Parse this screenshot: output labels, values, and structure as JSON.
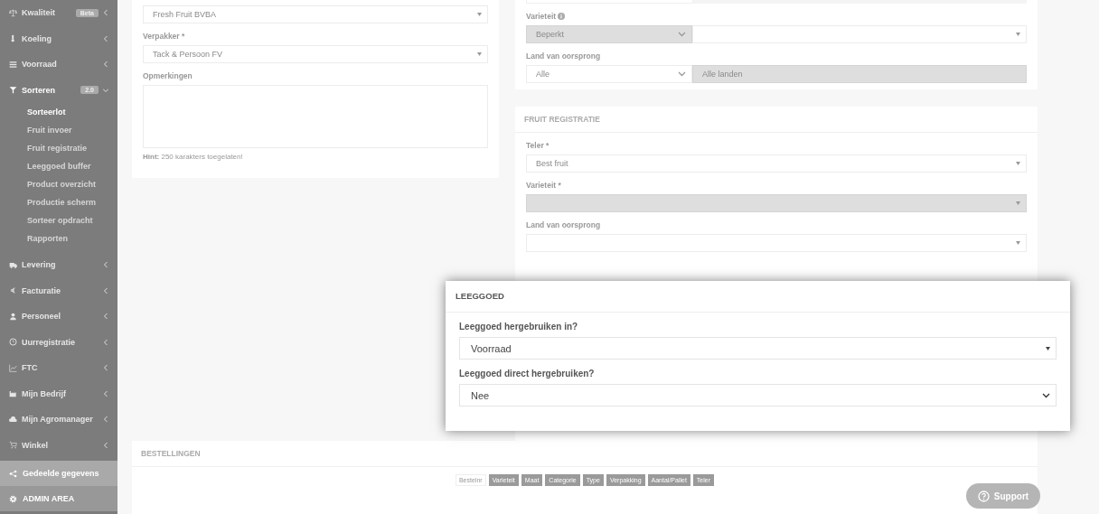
{
  "sidebar": {
    "items": [
      {
        "label": "Kwaliteit",
        "badge": "Beta",
        "expanded": false
      },
      {
        "label": "Koeling",
        "expanded": false
      },
      {
        "label": "Voorraad",
        "expanded": false
      },
      {
        "label": "Sorteren",
        "badge": "2.0",
        "expanded": true,
        "children": [
          {
            "label": "Sorteerlot",
            "selected": true
          },
          {
            "label": "Fruit invoer",
            "selected": false
          },
          {
            "label": "Fruit registratie",
            "selected": false
          },
          {
            "label": "Leeggoed buffer",
            "selected": false
          },
          {
            "label": "Product overzicht",
            "selected": false
          },
          {
            "label": "Productie scherm",
            "selected": false
          },
          {
            "label": "Sorteer opdracht",
            "selected": false
          },
          {
            "label": "Rapporten",
            "selected": false
          }
        ]
      },
      {
        "label": "Levering",
        "expanded": false
      },
      {
        "label": "Facturatie",
        "expanded": false
      },
      {
        "label": "Personeel",
        "expanded": false
      },
      {
        "label": "Uurregistratie",
        "expanded": false
      },
      {
        "label": "FTC",
        "expanded": false
      },
      {
        "label": "Mijn Bedrijf",
        "expanded": false
      },
      {
        "label": "Mijn Agromanager",
        "expanded": false
      },
      {
        "label": "Winkel",
        "expanded": false
      }
    ],
    "footer_items": [
      {
        "label": "Gedeelde gegevens",
        "kind": "shared"
      },
      {
        "label": "ADMIN AREA",
        "kind": "admin"
      }
    ]
  },
  "left_card": {
    "fields": [
      {
        "value": "Fresh Fruit BVBA"
      },
      {
        "label": "Verpakker *",
        "value": "Tack & Persoon FV"
      }
    ],
    "remarks": {
      "label": "Opmerkingen",
      "hint": "**Hint:** 250 karakters toegelaten!"
    }
  },
  "filter_card": {
    "rows": [
      {
        "label": "Varieteit",
        "info": true,
        "select": "Beperkt",
        "second": {
          "kind": "select"
        }
      },
      {
        "label": "Land van oorsprong",
        "info": false,
        "select": "Alle",
        "second": {
          "kind": "readonly",
          "value": "Alle landen"
        }
      }
    ]
  },
  "fruit_registratie": {
    "title": "FRUIT REGISTRATIE",
    "fields": [
      {
        "label": "Teler *",
        "value": "Best fruit",
        "disabled": false
      },
      {
        "label": "Varieteit *",
        "disabled": true
      },
      {
        "label": "Land van oorsprong",
        "disabled": false
      }
    ]
  },
  "modal": {
    "title": "LEEGGOED",
    "fields": [
      {
        "label": "Leeggoed hergebruiken in?",
        "value": "Voorraad",
        "kind": "select2"
      },
      {
        "label": "Leeggoed direct hergebruiken?",
        "value": "Nee",
        "kind": "native"
      }
    ]
  },
  "bestellingen": {
    "title": "BESTELLINGEN",
    "columns": [
      {
        "label": "Bestelnr",
        "selected": false
      },
      {
        "label": "Varieteit",
        "selected": true
      },
      {
        "label": "Maat",
        "selected": true
      },
      {
        "label": "Categorie",
        "selected": true
      },
      {
        "label": "Type",
        "selected": true
      },
      {
        "label": "Verpakking",
        "selected": true
      },
      {
        "label": "Aantal/Pallet",
        "selected": true
      },
      {
        "label": "Teler",
        "selected": true
      }
    ]
  },
  "support_button": "Support"
}
